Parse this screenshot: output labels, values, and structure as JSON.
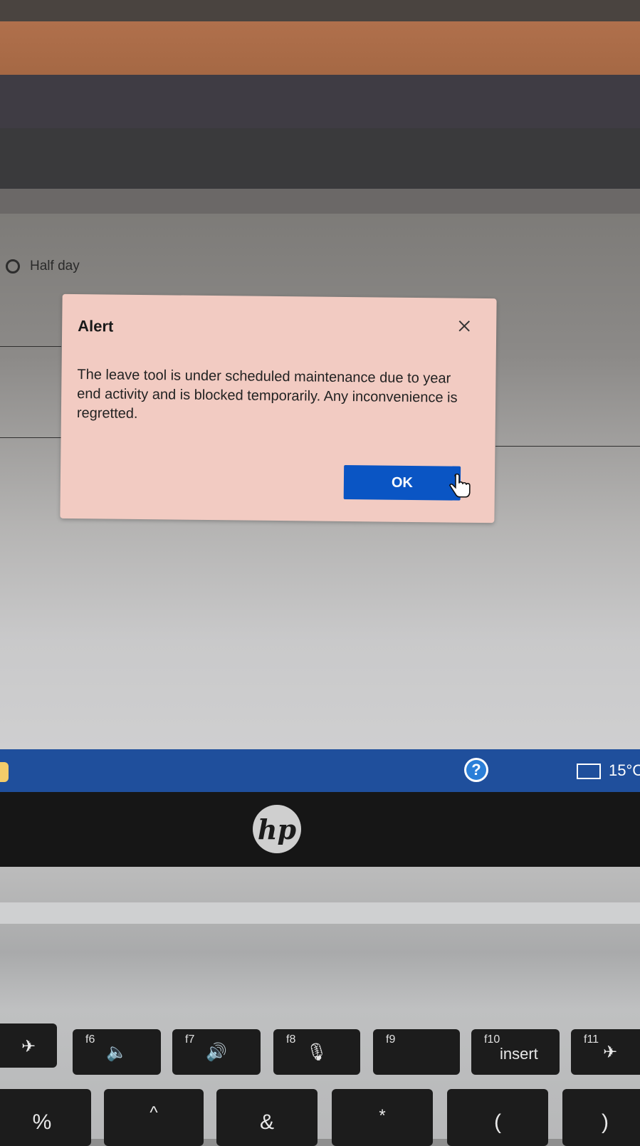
{
  "background": {
    "radio_option_label": "Half day"
  },
  "dialog": {
    "title": "Alert",
    "message": "The leave tool is under scheduled maintenance due to year end activity and is blocked temporarily. Any inconvenience is regretted.",
    "ok_label": "OK",
    "close_icon": "close-icon",
    "accent_color": "#0a55c4"
  },
  "taskbar": {
    "help_icon_label": "?",
    "temperature": "15°C",
    "news_icon": "news-icon"
  },
  "laptop": {
    "logo_text": "hp",
    "keys": [
      {
        "fn": "f6",
        "glyph": "🔈"
      },
      {
        "fn": "f7",
        "glyph": "🔊"
      },
      {
        "fn": "f8",
        "glyph": "🎙"
      },
      {
        "fn": "f9",
        "glyph": ""
      },
      {
        "fn": "f10",
        "word": "insert"
      },
      {
        "fn": "f11",
        "glyph": "✈"
      }
    ],
    "bottom_row": [
      "%",
      "^",
      "&",
      "*",
      "(",
      ")"
    ]
  }
}
